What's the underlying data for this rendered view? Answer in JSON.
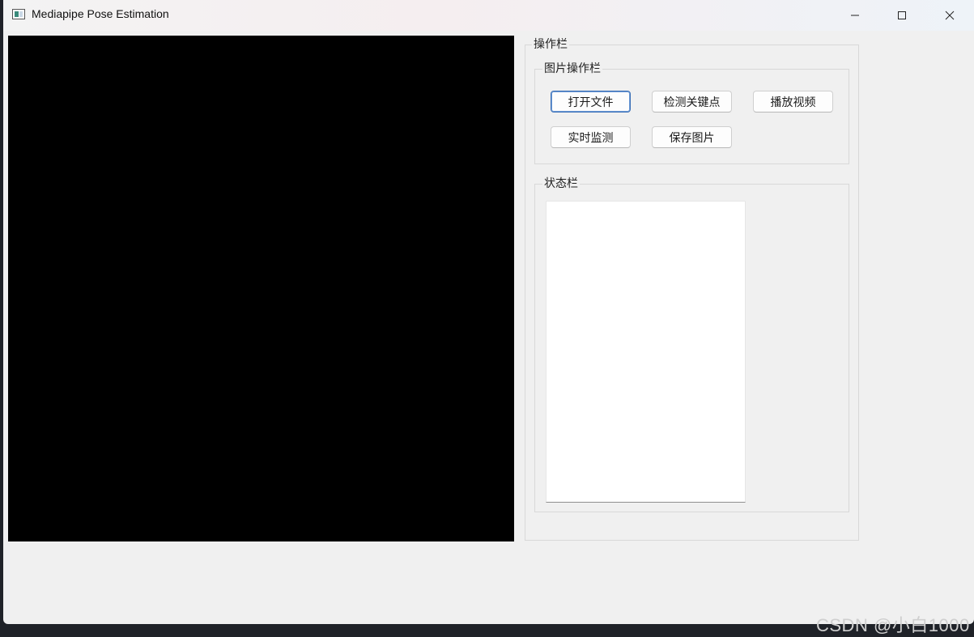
{
  "window": {
    "title": "Mediapipe Pose Estimation",
    "icon": "app-window-icon",
    "controls": [
      "minimize-icon",
      "maximize-icon",
      "close-icon"
    ]
  },
  "operation_group": {
    "title": "操作栏",
    "image_group": {
      "title": "图片操作栏",
      "buttons": [
        {
          "label": "打开文件"
        },
        {
          "label": "检测关键点"
        },
        {
          "label": "播放视频"
        },
        {
          "label": "实时监测"
        },
        {
          "label": "保存图片"
        }
      ]
    },
    "status_group": {
      "title": "状态栏",
      "text": ""
    }
  },
  "watermark": "CSDN @小白1000",
  "colors": {
    "video_background": "#000000",
    "window_background": "#f0f0f0",
    "focus_border": "#3b6fb6"
  }
}
